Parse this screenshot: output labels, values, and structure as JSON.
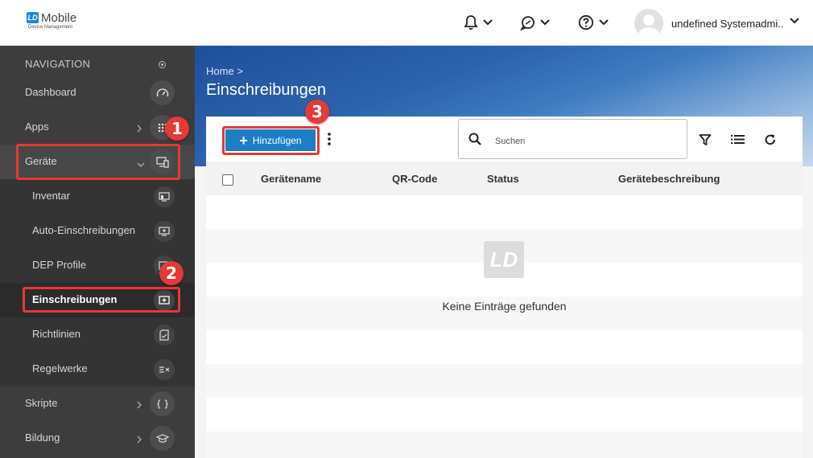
{
  "brand": {
    "mark": "LD",
    "title": "Mobile",
    "subtitle": "Device Management"
  },
  "topbar": {
    "user_name": "undefined Systemadmi..."
  },
  "sidebar": {
    "heading": "NAVIGATION",
    "items": [
      {
        "label": "Dashboard",
        "icon": "gauge-icon"
      },
      {
        "label": "Apps",
        "icon": "apps-grid-icon"
      },
      {
        "label": "Geräte",
        "icon": "devices-icon"
      },
      {
        "label": "Skripte",
        "icon": "braces-icon"
      },
      {
        "label": "Bildung",
        "icon": "graduation-cap-icon"
      }
    ],
    "subitems": [
      {
        "label": "Inventar",
        "icon": "inventory-icon"
      },
      {
        "label": "Auto-Einschreibungen",
        "icon": "auto-enroll-icon"
      },
      {
        "label": "DEP Profile",
        "icon": "dep-profile-icon"
      },
      {
        "label": "Einschreibungen",
        "icon": "enrollment-icon",
        "active": true
      },
      {
        "label": "Richtlinien",
        "icon": "policy-icon"
      },
      {
        "label": "Regelwerke",
        "icon": "ruleset-icon"
      }
    ]
  },
  "breadcrumb": {
    "home": "Home",
    "separator": ">"
  },
  "page": {
    "title": "Einschreibungen"
  },
  "toolbar": {
    "add_label": "Hinzufügen",
    "search_placeholder": "Suchen"
  },
  "table": {
    "columns": [
      "Gerätename",
      "QR-Code",
      "Status",
      "Gerätebeschreibung"
    ],
    "empty_mark": "LD",
    "empty_text": "Keine Einträge gefunden"
  },
  "annotations": [
    "1",
    "2",
    "3"
  ],
  "colors": {
    "accent": "#1c7ec5",
    "highlight": "#e53935",
    "sidebar_bg": "#3d3d3d"
  }
}
